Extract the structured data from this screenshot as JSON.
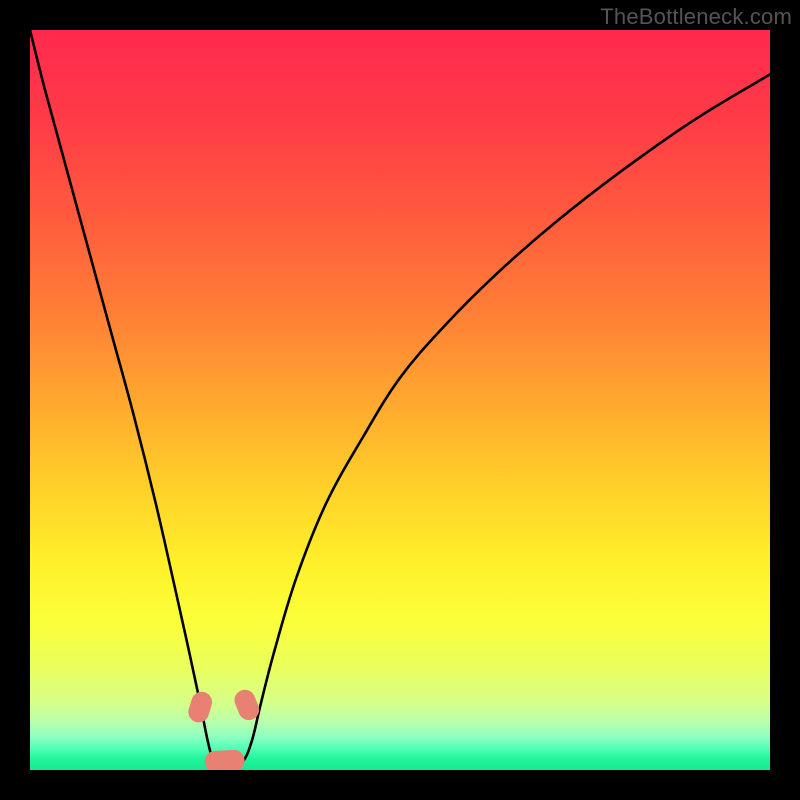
{
  "watermark": {
    "text": "TheBottleneck.com"
  },
  "colors": {
    "black": "#000000",
    "curve_stroke": "#000000",
    "marker_fill": "#e98074",
    "watermark": "#555555",
    "gradient_stops": [
      {
        "offset": 0.0,
        "color": "#ff2a4d"
      },
      {
        "offset": 0.12,
        "color": "#ff3b47"
      },
      {
        "offset": 0.25,
        "color": "#ff5a3e"
      },
      {
        "offset": 0.38,
        "color": "#ff7e36"
      },
      {
        "offset": 0.5,
        "color": "#ffa72f"
      },
      {
        "offset": 0.62,
        "color": "#ffd129"
      },
      {
        "offset": 0.72,
        "color": "#fff029"
      },
      {
        "offset": 0.8,
        "color": "#fbff3a"
      },
      {
        "offset": 0.86,
        "color": "#eaff5c"
      },
      {
        "offset": 0.905,
        "color": "#d8ff84"
      },
      {
        "offset": 0.935,
        "color": "#b9ffab"
      },
      {
        "offset": 0.955,
        "color": "#8effc2"
      },
      {
        "offset": 0.972,
        "color": "#4dffb3"
      },
      {
        "offset": 0.985,
        "color": "#21f59a"
      },
      {
        "offset": 1.0,
        "color": "#18e892"
      }
    ]
  },
  "chart_data": {
    "type": "line",
    "title": "",
    "xlabel": "",
    "ylabel": "",
    "xlim": [
      0,
      100
    ],
    "ylim": [
      0,
      100
    ],
    "grid": false,
    "series": [
      {
        "name": "bottleneck-curve",
        "x": [
          0,
          2,
          5,
          8,
          11,
          14,
          17,
          19.5,
          21.5,
          23,
          24,
          24.8,
          25.8,
          27.3,
          28.8,
          30,
          31.2,
          33,
          36,
          40,
          45,
          50,
          56,
          63,
          71,
          80,
          90,
          100
        ],
        "y": [
          100,
          92,
          81,
          70,
          59,
          48,
          36,
          25,
          16,
          9,
          4,
          1.2,
          0.6,
          0.6,
          1.2,
          4,
          9,
          16,
          26,
          36,
          45,
          53,
          60,
          67,
          74,
          81,
          88,
          94
        ]
      }
    ],
    "annotations": [
      {
        "name": "marker-left",
        "shape": "capsule",
        "cx": 23.0,
        "cy": 8.5,
        "angle_deg": 73,
        "length": 4.2,
        "radius": 1.4
      },
      {
        "name": "marker-right",
        "shape": "capsule",
        "cx": 29.3,
        "cy": 8.8,
        "angle_deg": -68,
        "length": 4.2,
        "radius": 1.4
      },
      {
        "name": "marker-bottom",
        "shape": "capsule",
        "cx": 26.3,
        "cy": 1.2,
        "angle_deg": 3,
        "length": 5.4,
        "radius": 1.45
      }
    ]
  }
}
